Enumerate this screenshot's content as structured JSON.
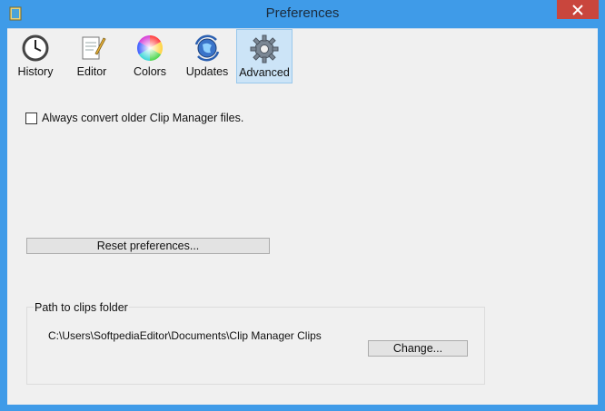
{
  "window": {
    "title": "Preferences"
  },
  "tabs": [
    {
      "label": "History",
      "icon": "clock-icon"
    },
    {
      "label": "Editor",
      "icon": "notepad-pencil-icon"
    },
    {
      "label": "Colors",
      "icon": "color-wheel-icon"
    },
    {
      "label": "Updates",
      "icon": "globe-refresh-icon"
    },
    {
      "label": "Advanced",
      "icon": "gear-icon",
      "active": true
    }
  ],
  "advanced": {
    "convert_checkbox_label": "Always convert older Clip Manager files.",
    "convert_checked": false,
    "reset_button": "Reset preferences...",
    "path_group_title": "Path to clips folder",
    "path_value": "C:\\Users\\SoftpediaEditor\\Documents\\Clip Manager Clips",
    "change_button": "Change..."
  },
  "colors": {
    "titlebar": "#3f9be8",
    "close_button": "#c9463d",
    "active_tab": "#cce4f7"
  }
}
